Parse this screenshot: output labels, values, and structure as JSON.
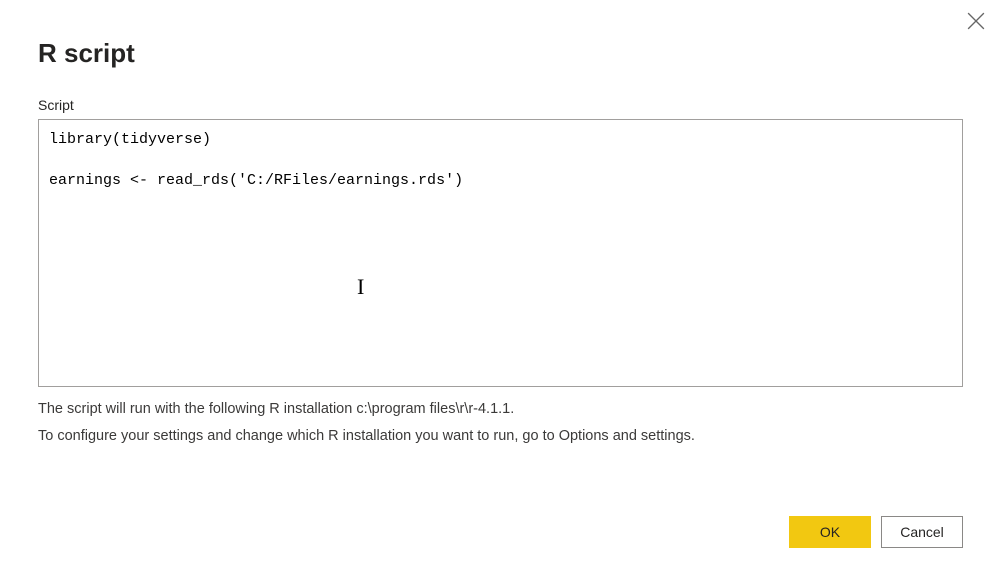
{
  "dialog": {
    "title": "R script",
    "close_icon_name": "close-icon"
  },
  "script": {
    "label": "Script",
    "content": "library(tidyverse)\n\nearnings <- read_rds('C:/RFiles/earnings.rds')"
  },
  "info": {
    "line1": "The script will run with the following R installation c:\\program files\\r\\r-4.1.1.",
    "line2": "To configure your settings and change which R installation you want to run, go to Options and settings."
  },
  "buttons": {
    "ok": "OK",
    "cancel": "Cancel"
  },
  "colors": {
    "accent": "#f2c811",
    "border": "#a19f9d",
    "text": "#252423"
  }
}
